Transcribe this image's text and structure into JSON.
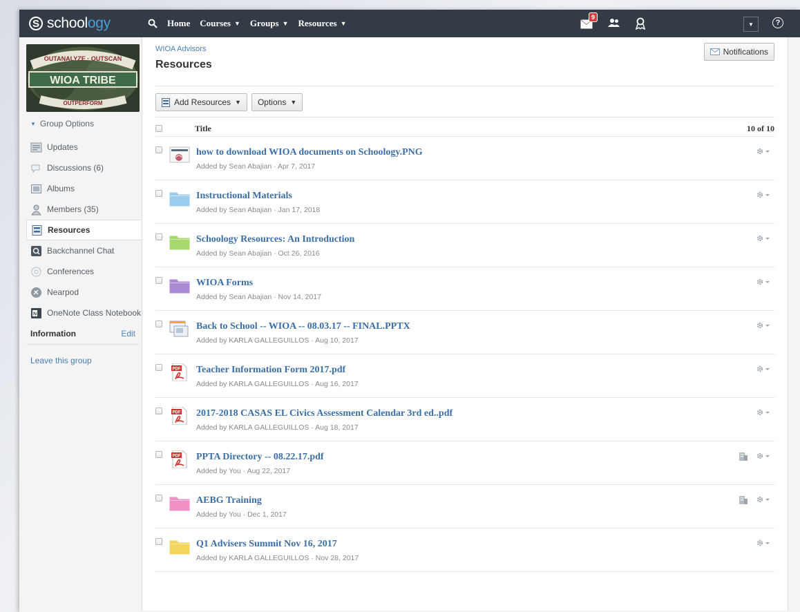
{
  "nav": {
    "logo_text": "schoology",
    "home": "Home",
    "courses": "Courses",
    "groups": "Groups",
    "resources": "Resources",
    "message_count": "9"
  },
  "sidebar": {
    "group_image_text": {
      "top": "OUTANALYZE · OUTSCAN",
      "middle": "WIOA TRIBE",
      "bottom": "OUTPERFORM"
    },
    "group_options": "Group Options",
    "items": [
      {
        "label": "Updates",
        "icon": "updates-icon"
      },
      {
        "label": "Discussions (6)",
        "icon": "discussions-icon"
      },
      {
        "label": "Albums",
        "icon": "albums-icon"
      },
      {
        "label": "Members (35)",
        "icon": "members-icon"
      },
      {
        "label": "Resources",
        "icon": "resources-icon"
      },
      {
        "label": "Backchannel Chat",
        "icon": "chat-icon"
      },
      {
        "label": "Conferences",
        "icon": "conferences-icon"
      },
      {
        "label": "Nearpod",
        "icon": "nearpod-icon"
      },
      {
        "label": "OneNote Class Notebook",
        "icon": "onenote-icon"
      }
    ],
    "information": "Information",
    "edit": "Edit",
    "leave": "Leave this group"
  },
  "main": {
    "breadcrumb": "WIOA Advisors",
    "title": "Resources",
    "notifications": "Notifications",
    "add_resources": "Add Resources",
    "options": "Options",
    "col_title": "Title",
    "count": "10 of 10"
  },
  "resources": [
    {
      "name": "how to download WIOA documents on Schoology.PNG",
      "meta": "Added by Sean Abajian · Apr 7, 2017",
      "type": "image"
    },
    {
      "name": "Instructional Materials",
      "meta": "Added by Sean Abajian · Jan 17, 2018",
      "type": "folder",
      "color": "#9ccbeb"
    },
    {
      "name": "Schoology Resources: An Introduction",
      "meta": "Added by Sean Abajian · Oct 26, 2016",
      "type": "folder",
      "color": "#a6d86e"
    },
    {
      "name": "WIOA Forms",
      "meta": "Added by Sean Abajian · Nov 14, 2017",
      "type": "folder",
      "color": "#a98ad3"
    },
    {
      "name": "Back to School -- WIOA -- 08.03.17 -- FINAL.PPTX",
      "meta": "Added by KARLA GALLEGUILLOS · Aug 10, 2017",
      "type": "pptx"
    },
    {
      "name": "Teacher Information Form 2017.pdf",
      "meta": "Added by KARLA GALLEGUILLOS · Aug 16, 2017",
      "type": "pdf"
    },
    {
      "name": "2017-2018 CASAS EL Civics Assessment Calendar 3rd ed..pdf",
      "meta": "Added by KARLA GALLEGUILLOS · Aug 18, 2017",
      "type": "pdf"
    },
    {
      "name": "PPTA Directory -- 08.22.17.pdf",
      "meta": "Added by You · Aug 22, 2017",
      "type": "pdf",
      "shared": true
    },
    {
      "name": "AEBG Training",
      "meta": "Added by You · Dec 1, 2017",
      "type": "folder",
      "color": "#ef8fc4",
      "shared": true
    },
    {
      "name": "Q1 Advisers Summit Nov 16, 2017",
      "meta": "Added by KARLA GALLEGUILLOS · Nov 28, 2017",
      "type": "folder",
      "color": "#f3d45c"
    }
  ]
}
